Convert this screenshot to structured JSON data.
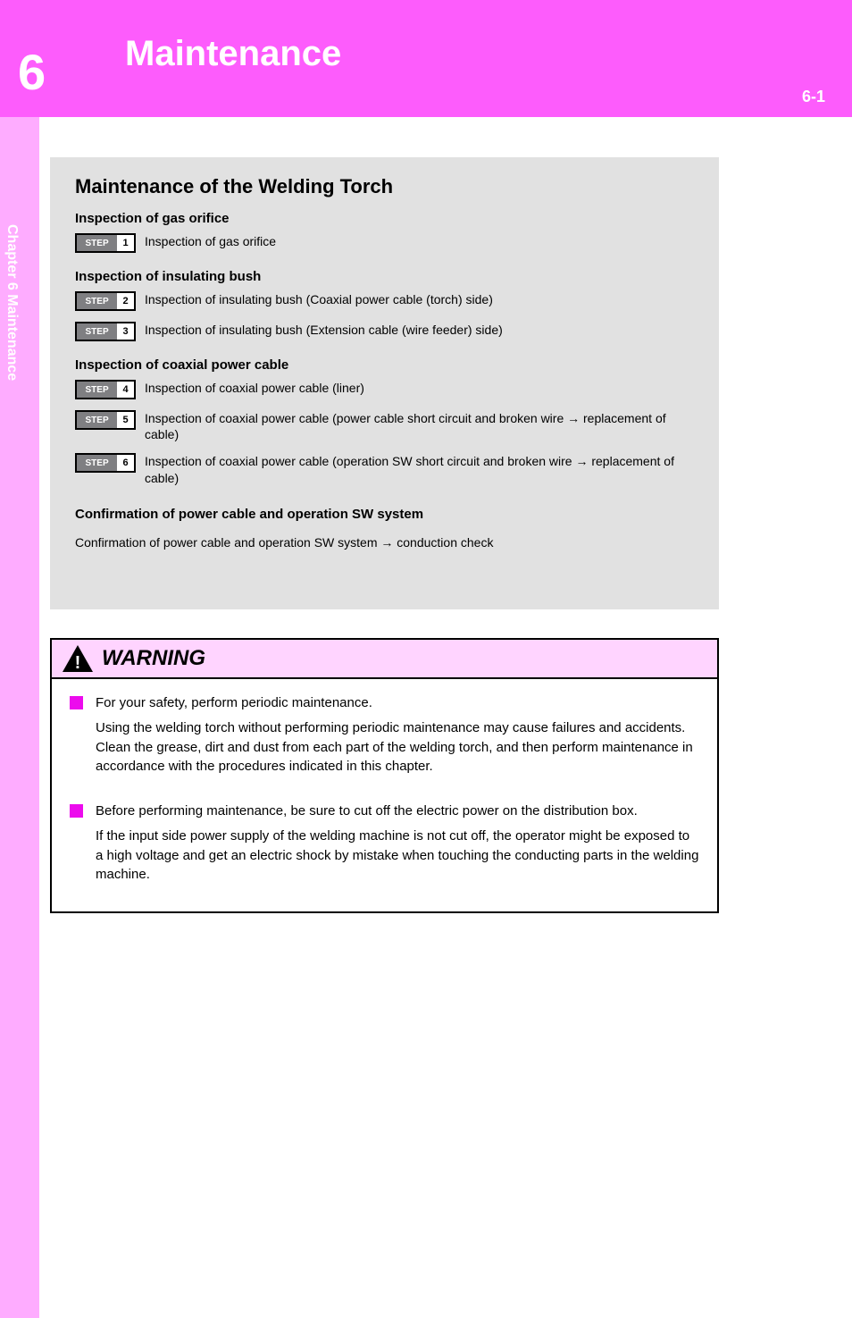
{
  "header": {
    "pageNumber": "6-1",
    "chapterNumber": "6",
    "chapterTitle": "Maintenance"
  },
  "sidebar": {
    "label": "Chapter 6   Maintenance"
  },
  "graybox": {
    "title": "Maintenance of the Welding Torch",
    "sections": {
      "gasLabel": "Inspection of gas orifice",
      "gasStep": {
        "num": "1",
        "text": "Inspection of gas orifice"
      },
      "insLabel": "Inspection of insulating bush",
      "insStep1": {
        "num": "2",
        "text": "Inspection of insulating bush (Coaxial power cable (torch) side)"
      },
      "insStep2": {
        "num": "3",
        "text": "Inspection of insulating bush (Extension cable (wire feeder) side)"
      },
      "cableLabel": "Inspection of coaxial power cable",
      "cableStep1": {
        "num": "4",
        "text": "Inspection of coaxial power cable (liner)"
      },
      "cableStep2": {
        "num": "5",
        "text": "Inspection of coaxial power cable (power cable short circuit and broken wire → replacement of cable)"
      },
      "cableStep3": {
        "num": "6",
        "text": "Inspection of coaxial power cable (operation SW short circuit and broken wire → replacement of cable)"
      },
      "flowLabel": "Confirmation of power cable and operation SW system",
      "flow": "Confirmation of power cable and operation SW system → conduction check"
    }
  },
  "warning": {
    "title": "WARNING",
    "item1": "For your safety, perform periodic maintenance.",
    "item1sub": "Using the welding torch without performing periodic maintenance may cause failures and accidents. Clean the grease, dirt and dust from each part of the welding torch, and then perform maintenance in accordance with the procedures indicated in this chapter.",
    "item2": "Before performing maintenance, be sure to cut off the electric power on the distribution box.",
    "item2sub": "If the input side power supply of the welding machine is not cut off, the operator might be exposed to a high voltage and get an electric shock by mistake when touching the conducting parts in the welding machine."
  }
}
